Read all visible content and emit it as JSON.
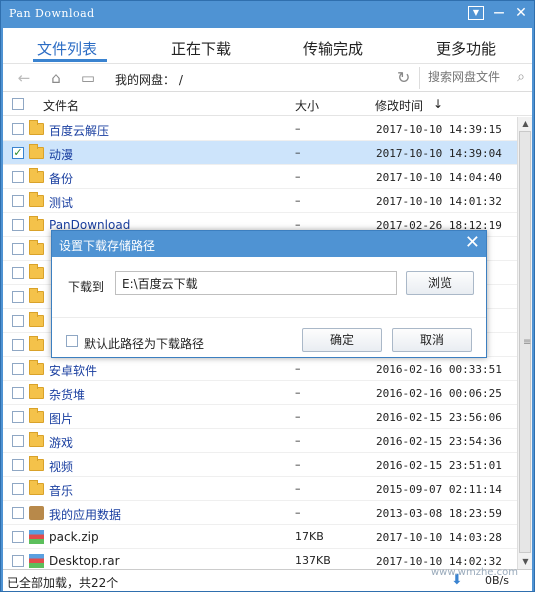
{
  "window": {
    "title": "Pan Download"
  },
  "tabs": [
    {
      "label": "文件列表",
      "active": true
    },
    {
      "label": "正在下载",
      "active": false
    },
    {
      "label": "传输完成",
      "active": false
    },
    {
      "label": "更多功能",
      "active": false
    }
  ],
  "toolbar": {
    "icons": [
      "back-arrow-icon",
      "home-icon",
      "folder-icon",
      "refresh-icon",
      "search-icon"
    ],
    "path": "我的网盘： /",
    "search_placeholder": "搜索网盘文件"
  },
  "table": {
    "headers": {
      "name": "文件名",
      "size": "大小",
      "modified": "修改时间",
      "sort_indicator": "↓"
    },
    "rows": [
      {
        "name": "百度云解压",
        "size": "–",
        "modified": "2017-10-10 14:39:15",
        "type": "folder",
        "checked": false
      },
      {
        "name": "动漫",
        "size": "–",
        "modified": "2017-10-10 14:39:04",
        "type": "folder",
        "checked": true
      },
      {
        "name": "备份",
        "size": "–",
        "modified": "2017-10-10 14:04:40",
        "type": "folder",
        "checked": false
      },
      {
        "name": "测试",
        "size": "–",
        "modified": "2017-10-10 14:01:32",
        "type": "folder",
        "checked": false
      },
      {
        "name": "PanDownload",
        "size": "–",
        "modified": "2017-02-26 18:12:19",
        "type": "folder",
        "checked": false
      },
      {
        "name": "",
        "size": "",
        "modified": "",
        "type": "folder",
        "checked": false
      },
      {
        "name": "",
        "size": "",
        "modified": "",
        "type": "folder",
        "checked": false
      },
      {
        "name": "",
        "size": "",
        "modified": "",
        "type": "folder",
        "checked": false
      },
      {
        "name": "",
        "size": "",
        "modified": "",
        "type": "folder",
        "checked": false
      },
      {
        "name": "",
        "size": "",
        "modified": "",
        "type": "folder",
        "checked": false
      },
      {
        "name": "安卓软件",
        "size": "–",
        "modified": "2016-02-16 00:33:51",
        "type": "folder",
        "checked": false
      },
      {
        "name": "杂货堆",
        "size": "–",
        "modified": "2016-02-16 00:06:25",
        "type": "folder",
        "checked": false
      },
      {
        "name": "图片",
        "size": "–",
        "modified": "2016-02-15 23:56:06",
        "type": "folder",
        "checked": false
      },
      {
        "name": "游戏",
        "size": "–",
        "modified": "2016-02-15 23:54:36",
        "type": "folder",
        "checked": false
      },
      {
        "name": "视频",
        "size": "–",
        "modified": "2016-02-15 23:51:01",
        "type": "folder",
        "checked": false
      },
      {
        "name": "音乐",
        "size": "–",
        "modified": "2015-09-07 02:11:14",
        "type": "folder",
        "checked": false
      },
      {
        "name": "我的应用数据",
        "size": "–",
        "modified": "2013-03-08 18:23:59",
        "type": "app",
        "checked": false
      },
      {
        "name": "pack.zip",
        "size": "17KB",
        "modified": "2017-10-10 14:03:28",
        "type": "zip",
        "checked": false
      },
      {
        "name": "Desktop.rar",
        "size": "137KB",
        "modified": "2017-10-10 14:02:32",
        "type": "zip",
        "checked": false
      }
    ]
  },
  "status": {
    "loaded_text": "已全部加载，共22个",
    "speed": "0B/s"
  },
  "watermark": "www.wmzhe.com",
  "dialog": {
    "title": "设置下载存储路径",
    "label": "下载到",
    "path_value": "E:\\百度云下载",
    "browse_label": "浏览",
    "default_label": "默认此路径为下载路径",
    "default_checked": false,
    "ok_label": "确定",
    "cancel_label": "取消"
  }
}
